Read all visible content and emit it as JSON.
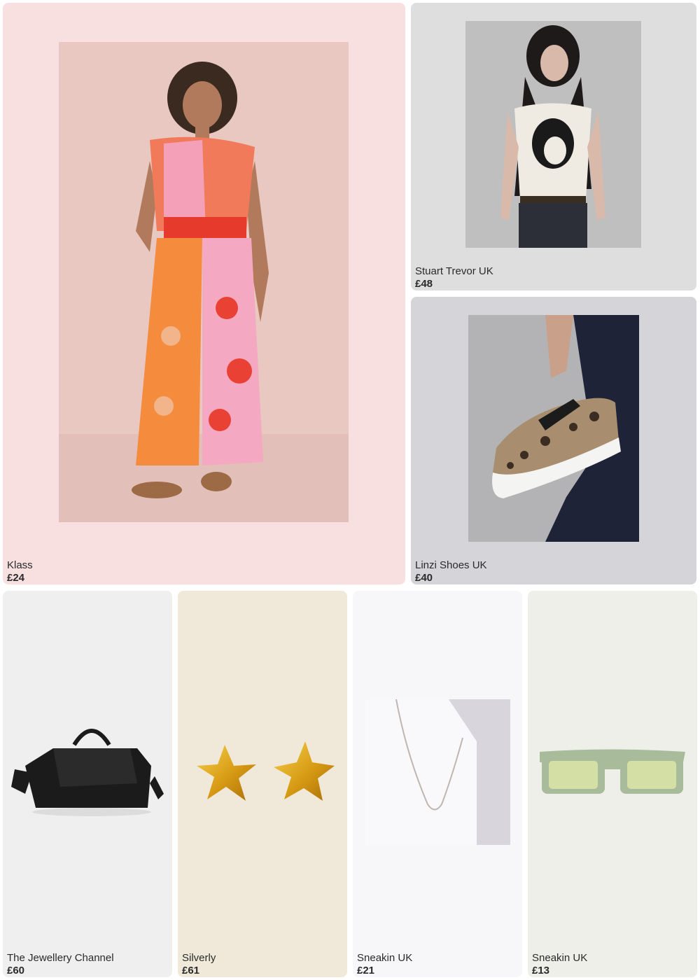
{
  "products": [
    {
      "brand": "Klass",
      "price": "£24",
      "bg": "#f7e0df",
      "image": "patterned-jumpsuit-photo"
    },
    {
      "brand": "Stuart Trevor UK",
      "price": "£48",
      "bg": "#dededf",
      "image": "graphic-tshirt-photo"
    },
    {
      "brand": "Linzi Shoes UK",
      "price": "£40",
      "bg": "#d5d4d9",
      "image": "leopard-sneakers-photo"
    },
    {
      "brand": "The Jewellery Channel",
      "price": "£60",
      "bg": "#efefef",
      "image": "black-handbag-photo"
    },
    {
      "brand": "Silverly",
      "price": "£61",
      "bg": "#f0e9d9",
      "image": "gold-star-earrings-photo"
    },
    {
      "brand": "Sneakin UK",
      "price": "£21",
      "bg": "#f7f6f8",
      "image": "silver-chain-necklace-photo"
    },
    {
      "brand": "Sneakin UK",
      "price": "£13",
      "bg": "#eeefe9",
      "image": "green-sunglasses-photo"
    }
  ]
}
